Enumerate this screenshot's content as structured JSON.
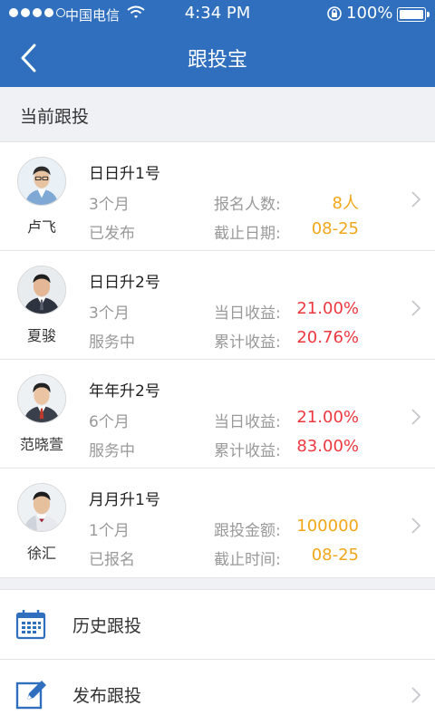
{
  "status_bar": {
    "carrier": "中国电信",
    "time": "4:34 PM",
    "battery": "100%"
  },
  "nav": {
    "title": "跟投宝"
  },
  "section": {
    "label": "当前跟投"
  },
  "items": [
    {
      "person": "卢飞",
      "product": "日日升1号",
      "period": "3个月",
      "status": "已发布",
      "k1": "报名人数:",
      "v1": "8人",
      "k2": "截止日期:",
      "v2": "08-25",
      "v1_color": "#f2a71b",
      "v2_color": "#f2a71b"
    },
    {
      "person": "夏骏",
      "product": "日日升2号",
      "period": "3个月",
      "status": "服务中",
      "k1": "当日收益:",
      "v1": "21.00%",
      "k2": "累计收益:",
      "v2": "20.76%",
      "v1_color": "#ee3840",
      "v2_color": "#ee3840"
    },
    {
      "person": "范晓萱",
      "product": "年年升2号",
      "period": "6个月",
      "status": "服务中",
      "k1": "当日收益:",
      "v1": "21.00%",
      "k2": "累计收益:",
      "v2": "83.00%",
      "v1_color": "#ee3840",
      "v2_color": "#ee3840"
    },
    {
      "person": "徐汇",
      "product": "月月升1号",
      "period": "1个月",
      "status": "已报名",
      "k1": "跟投金额:",
      "v1": "100000",
      "k2": "截止时间:",
      "v2": "08-25",
      "v1_color": "#f2a71b",
      "v2_color": "#f2a71b"
    }
  ],
  "menu": {
    "history": "历史跟投",
    "publish": "发布跟投"
  },
  "colors": {
    "header": "#2f6fbe",
    "orange": "#f2a71b",
    "red": "#ee3840"
  }
}
